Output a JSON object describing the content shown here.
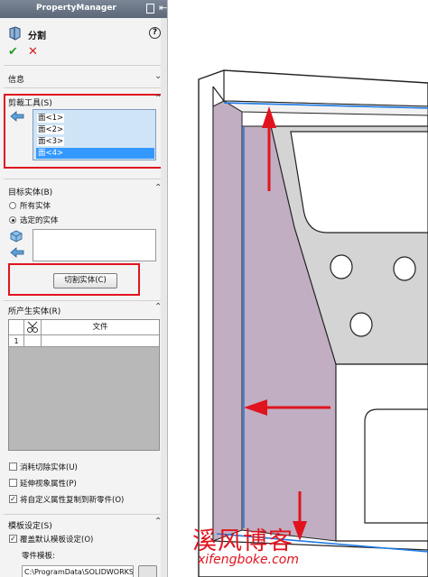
{
  "window": {
    "title": "PropertyManager"
  },
  "feature": {
    "name": "分割"
  },
  "sections": {
    "info": {
      "title": "信息"
    },
    "trim_tools": {
      "title": "剪裁工具(S)",
      "items": [
        {
          "label": "面<1>",
          "selected": false
        },
        {
          "label": "面<2>",
          "selected": false
        },
        {
          "label": "面<3>",
          "selected": false
        },
        {
          "label": "面<4>",
          "selected": true
        }
      ]
    },
    "target_bodies": {
      "title": "目标实体(B)",
      "options": [
        {
          "label": "所有实体",
          "checked": false
        },
        {
          "label": "选定的实体",
          "checked": true
        }
      ],
      "cut_button": "切割实体(C)"
    },
    "resulting_bodies": {
      "title": "所产生实体(R)",
      "file_header": "文件",
      "rows": [
        {
          "index": "1",
          "file": ""
        }
      ]
    },
    "options": [
      {
        "label": "消耗切除实体(U)",
        "checked": false
      },
      {
        "label": "延伸视象属性(P)",
        "checked": false
      },
      {
        "label": "将自定义属性复制到新零件(O)",
        "checked": true
      }
    ],
    "template": {
      "title": "模板设定(S)",
      "override_label": "覆盖默认模板设定(O)",
      "override_checked": true,
      "part_template_label": "零件模板:",
      "part_template_path": "C:\\ProgramData\\SOLIDWORKS"
    }
  },
  "icons": {
    "ok": "checkmark-icon",
    "cancel": "x-icon",
    "help": "help-icon",
    "pin": "pushpin-icon"
  },
  "watermark": {
    "text": "溪风博客",
    "url": "xifengboke.com"
  },
  "colors": {
    "highlight_red": "#e0141e",
    "selection_blue": "#3399ff",
    "face_purple": "#c1aec2",
    "edge_blue": "#1e7be6"
  }
}
